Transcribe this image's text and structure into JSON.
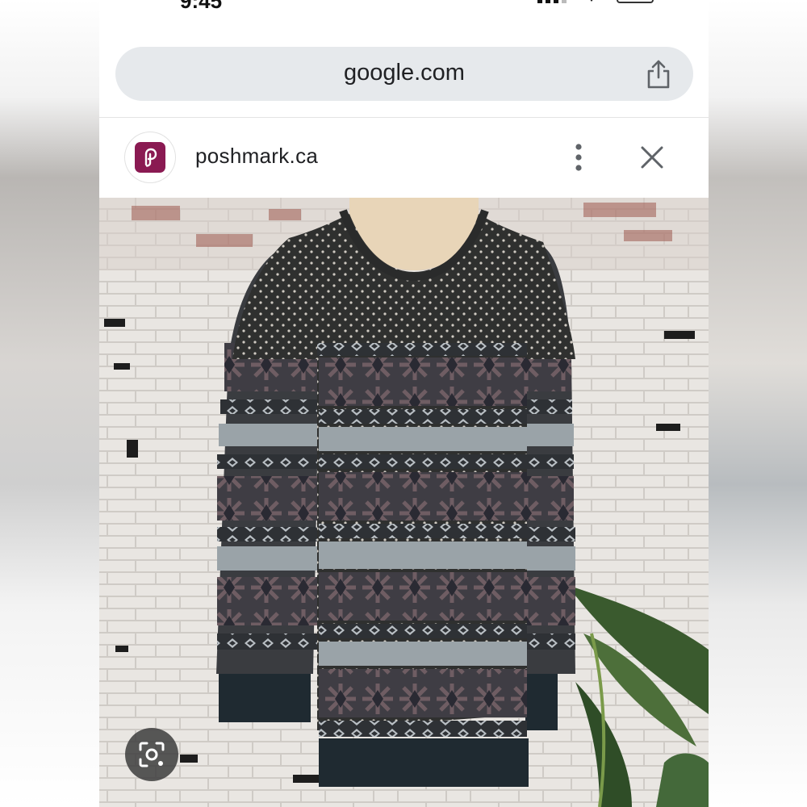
{
  "status_bar": {
    "time": "9:45"
  },
  "browser": {
    "url": "google.com",
    "icons": {
      "share": "share-icon"
    }
  },
  "site_header": {
    "site_name": "poshmark.ca",
    "favicon_color": "#8a1a52",
    "icons": {
      "menu": "more-vert-icon",
      "close": "close-icon"
    }
  },
  "image": {
    "description_icon": "sweater-photo",
    "lens_icon": "lens-search-icon"
  },
  "colors": {
    "url_bar_bg": "#e6e9ec",
    "text": "#202124"
  }
}
